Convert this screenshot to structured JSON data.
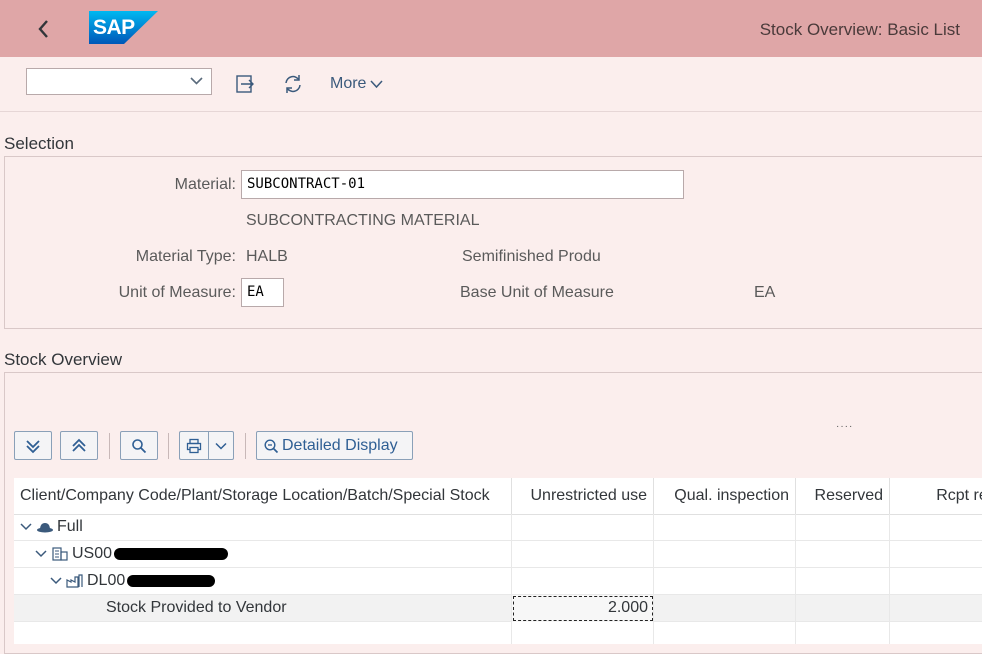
{
  "shell": {
    "title": "Stock Overview: Basic List",
    "logo_text": "SAP"
  },
  "toolbar": {
    "dropdown_value": "",
    "more_label": "More"
  },
  "selection": {
    "title": "Selection",
    "material_label": "Material:",
    "material_value": "SUBCONTRACT-01",
    "material_desc": "SUBCONTRACTING MATERIAL",
    "material_type_label": "Material Type:",
    "material_type_value": "HALB",
    "material_type_desc": "Semifinished Produ",
    "uom_label": "Unit of Measure:",
    "uom_value": "EA",
    "base_uom_label": "Base Unit of Measure",
    "base_uom_value": "EA"
  },
  "stock_overview": {
    "title": "Stock Overview",
    "detailed_display_label": "Detailed Display",
    "columns": [
      "Client/Company Code/Plant/Storage Location/Batch/Special Stock",
      "Unrestricted use",
      "Qual. inspection",
      "Reserved",
      "Rcpt reser"
    ],
    "rows": [
      {
        "label": "Full",
        "unrestricted": "",
        "qual": "",
        "reserved": "",
        "rcpt": ""
      },
      {
        "label": "US00",
        "unrestricted": "",
        "qual": "",
        "reserved": "",
        "rcpt": ""
      },
      {
        "label": "DL00",
        "unrestricted": "",
        "qual": "",
        "reserved": "",
        "rcpt": ""
      },
      {
        "label": "Stock Provided to Vendor",
        "unrestricted": "2.000",
        "qual": "",
        "reserved": "",
        "rcpt": ""
      }
    ]
  },
  "colors": {
    "shell_bg": "#dfa6a7",
    "page_bg": "#fbeeed",
    "link": "#2f5f94"
  }
}
